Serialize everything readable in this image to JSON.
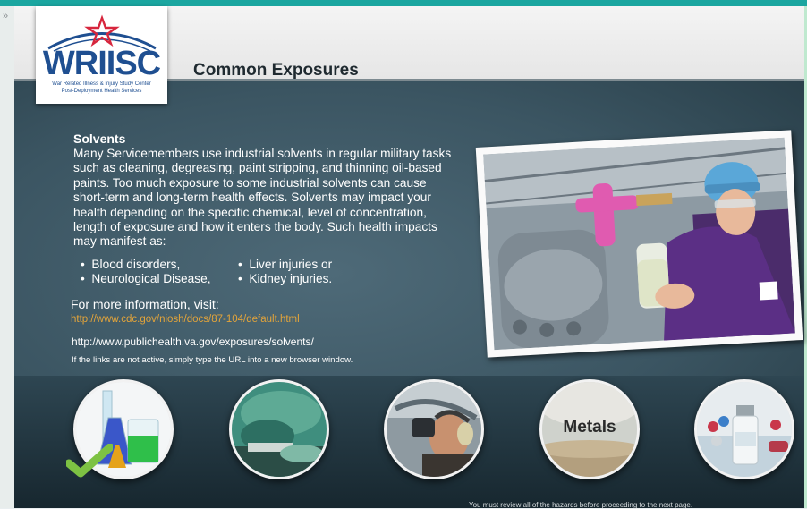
{
  "header": {
    "title": "Common Exposures",
    "logo": {
      "name": "WRIISC",
      "line1": "War Related Illness & Injury Study Center",
      "line2": "Post-Deployment Health Services"
    }
  },
  "content": {
    "section_title": "Solvents",
    "body": "Many Servicemembers use industrial solvents in regular military tasks such as cleaning, degreasing, paint stripping, and thinning oil-based paints.  Too much exposure to some industrial solvents can cause short-term and long-term health effects.  Solvents may impact your health depending on the specific chemical, level of concentration, length of exposure and how it enters the body.  Such health impacts may manifest as:",
    "bullets": [
      "Blood disorders,",
      "Neurological Disease,",
      "Liver injuries or",
      "Kidney injuries."
    ],
    "more_info_label": "For more information, visit:",
    "links": [
      "http://www.cdc.gov/niosh/docs/87-104/default.html",
      "http://www.publichealth.va.gov/exposures/solvents/"
    ],
    "note": "If the links are not active, simply type the URL into a new browser window."
  },
  "hazards": {
    "metals_label": "Metals"
  },
  "footer": {
    "note": "You must review all of the hazards before proceeding to the next page."
  },
  "colors": {
    "accent_top": "#1ba6a0",
    "link_orange": "#e3a43a",
    "logo_blue": "#1f4f91",
    "logo_star": "#d7263d",
    "check_green": "#7dc243"
  },
  "icons": {
    "expand": "double-chevron-right-icon",
    "completed": "checkmark-icon"
  }
}
